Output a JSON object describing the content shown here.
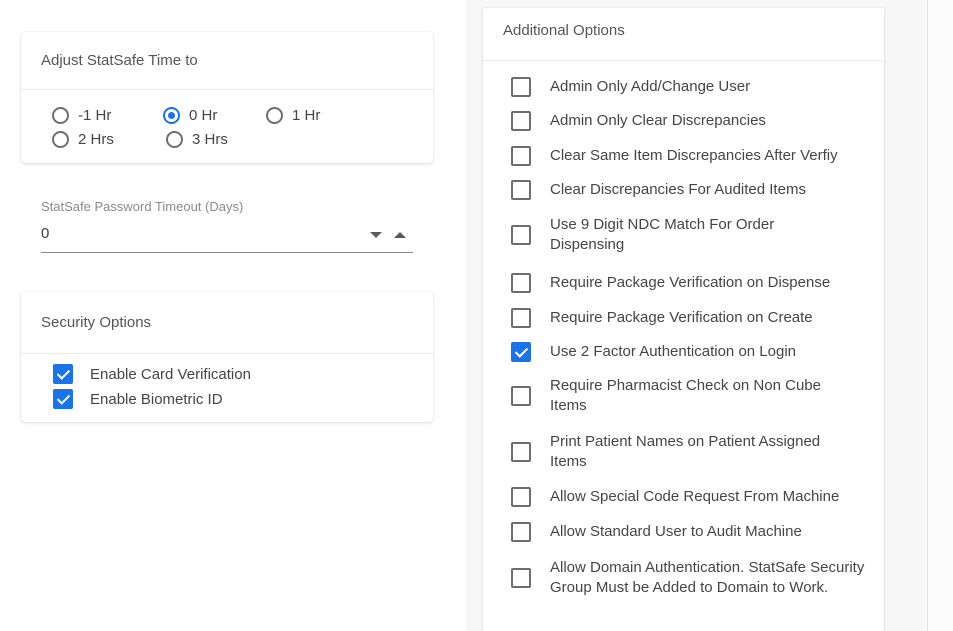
{
  "time_card": {
    "title": "Adjust StatSafe Time to",
    "options": [
      {
        "label": "-1 Hr",
        "checked": false
      },
      {
        "label": "0 Hr",
        "checked": true
      },
      {
        "label": "1 Hr",
        "checked": false
      },
      {
        "label": "2 Hrs",
        "checked": false
      },
      {
        "label": "3 Hrs",
        "checked": false
      }
    ]
  },
  "timeout_field": {
    "label": "StatSafe Password Timeout (Days)",
    "value": "0"
  },
  "security_card": {
    "title": "Security Options",
    "items": [
      {
        "label": "Enable Card Verification",
        "checked": true
      },
      {
        "label": "Enable Biometric ID",
        "checked": true
      }
    ]
  },
  "additional_options": {
    "title": "Additional Options",
    "items": [
      {
        "label": "Admin Only Add/Change User",
        "checked": false
      },
      {
        "label": "Admin Only Clear Discrepancies",
        "checked": false
      },
      {
        "label": "Clear Same Item Discrepancies After Verfiy",
        "checked": false
      },
      {
        "label": "Clear Discrepancies For Audited Items",
        "checked": false
      },
      {
        "label": "Use 9 Digit NDC Match For Order Dispensing",
        "checked": false
      },
      {
        "label": "Require Package Verification on Dispense",
        "checked": false
      },
      {
        "label": "Require Package Verification on Create",
        "checked": false
      },
      {
        "label": "Use 2 Factor Authentication on Login",
        "checked": true
      },
      {
        "label": "Require Pharmacist Check on Non Cube Items",
        "checked": false
      },
      {
        "label": "Print Patient Names on Patient Assigned Items",
        "checked": false
      },
      {
        "label": "Allow Special Code Request From Machine",
        "checked": false
      },
      {
        "label": "Allow Standard User to Audit Machine",
        "checked": false
      },
      {
        "label": "Allow Domain Authentication. StatSafe Security Group Must be Added to Domain to Work.",
        "checked": false
      }
    ]
  },
  "colors": {
    "accent": "#1a73e8",
    "text": "#454545",
    "muted": "#8a8a8a"
  }
}
